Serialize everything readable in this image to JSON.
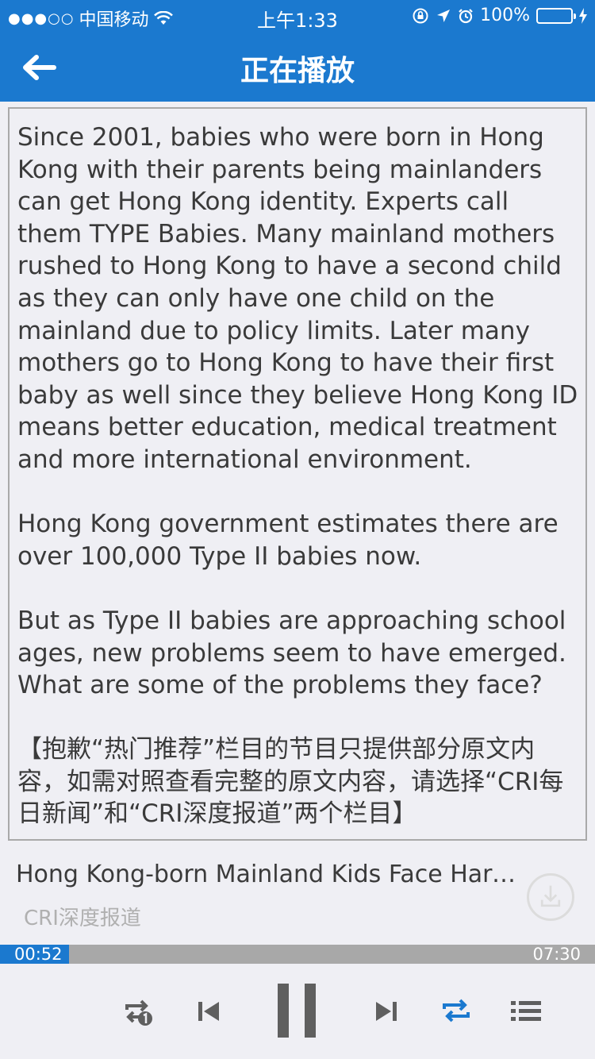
{
  "status_bar": {
    "signal_dots": "●●●○○",
    "carrier": "中国移动",
    "time": "上午1:33",
    "battery_percent": "100%"
  },
  "nav": {
    "title": "正在播放",
    "back_icon": "arrow-left-icon"
  },
  "transcript": {
    "paragraphs": [
      "Since 2001, babies who were born in Hong Kong with their parents being mainlanders can get Hong Kong identity. Experts call them TYPE Babies. Many mainland mothers rushed to Hong Kong to have a second child as they can only have one child on the mainland due to policy limits. Later many mothers go to Hong Kong to have their first baby as well since they believe Hong Kong ID means better education, medical treatment and more international environment.",
      "Hong Kong government estimates there are over 100,000 Type II babies now.",
      "But as Type II babies are approaching school ages, new problems seem to have emerged. What are some of the problems they face?",
      "【抱歉“热门推荐”栏目的节目只提供部分原文内容，如需对照查看完整的原文内容，请选择“CRI每日新闻”和“CRI深度报道”两个栏目】"
    ]
  },
  "track": {
    "title": "Hong Kong-born Mainland Kids Face Hard...",
    "program": "CRI深度报道"
  },
  "player": {
    "current_time": "00:52",
    "total_time": "07:30",
    "progress_fraction": 0.1156
  },
  "colors": {
    "accent": "#1b79cf",
    "icon_gray": "#5f5f5f",
    "track_gray": "#a8a8a8"
  }
}
